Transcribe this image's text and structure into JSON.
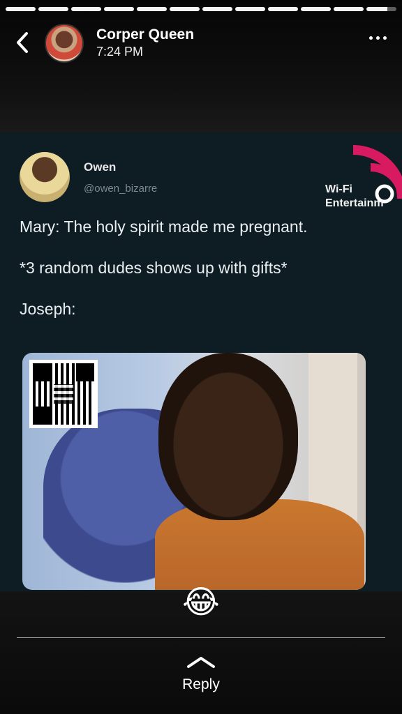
{
  "story": {
    "progress_segments": 12,
    "current_segment_fill": 0.7,
    "user_name": "Corper Queen",
    "time": "7:24 PM"
  },
  "tweet": {
    "name": "Owen",
    "handle": "@owen_bizarre",
    "lines": [
      "Mary: The holy spirit made me pregnant.",
      "*3 random dudes shows up with gifts*",
      "Joseph:"
    ],
    "watermark_line1": "Wi-Fi",
    "watermark_line2": "Entertainm"
  },
  "reaction": {
    "emoji": "😂"
  },
  "footer": {
    "reply_label": "Reply"
  },
  "icons": {
    "back": "back-chevron-icon",
    "more": "more-dots-icon",
    "reply": "chevron-up-icon",
    "wifi": "wifi-logo-icon"
  },
  "colors": {
    "tweet_bg": "#0e1c24",
    "wifi_brand": "#d81b60"
  }
}
